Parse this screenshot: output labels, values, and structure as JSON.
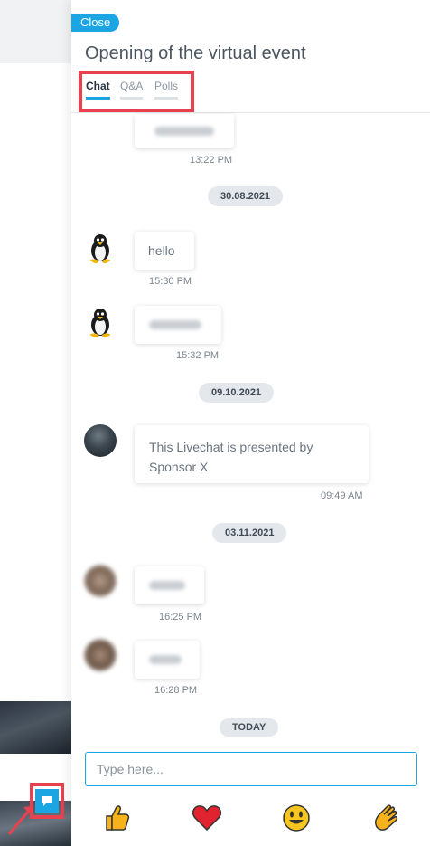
{
  "panel": {
    "close_label": "Close",
    "title": "Opening of the virtual event",
    "tabs": [
      {
        "label": "Chat",
        "active": true
      },
      {
        "label": "Q&A",
        "active": false
      },
      {
        "label": "Polls",
        "active": false
      }
    ]
  },
  "messages": [
    {
      "time": "13:22 PM"
    },
    {
      "text": "hello",
      "time": "15:30 PM"
    },
    {
      "time": "15:32 PM"
    },
    {
      "text": "This Livechat is presented by Sponsor X",
      "time": "09:49 AM"
    },
    {
      "time": "16:25 PM"
    },
    {
      "time": "16:28 PM"
    }
  ],
  "dates": [
    "30.08.2021",
    "09.10.2021",
    "03.11.2021",
    "TODAY"
  ],
  "input": {
    "placeholder": "Type here..."
  },
  "reactions": [
    "thumbs-up-icon",
    "heart-icon",
    "smile-icon",
    "clap-icon"
  ],
  "colors": {
    "accent": "#1ba6e3",
    "highlight": "#e8414f"
  }
}
